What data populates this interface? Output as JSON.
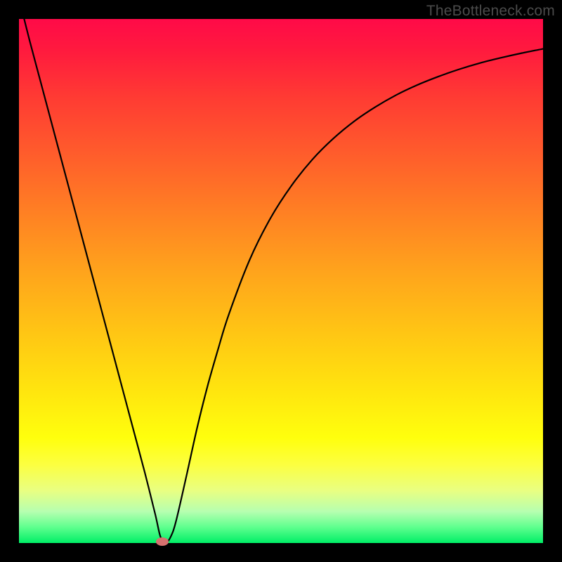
{
  "watermark": "TheBottleneck.com",
  "chart_data": {
    "type": "line",
    "title": "",
    "xlabel": "",
    "ylabel": "",
    "xlim": [
      0,
      100
    ],
    "ylim": [
      0,
      100
    ],
    "grid": false,
    "background_gradient": {
      "top": "#ff0a48",
      "mid": "#ffc614",
      "bottom": "#00ee66"
    },
    "series": [
      {
        "name": "bottleneck-curve",
        "x": [
          0,
          2,
          4,
          6,
          8,
          10,
          12,
          14,
          16,
          18,
          20,
          22,
          24,
          26,
          27,
          28,
          29,
          30,
          32,
          34,
          36,
          38,
          40,
          44,
          48,
          52,
          56,
          60,
          64,
          68,
          72,
          76,
          80,
          84,
          88,
          92,
          96,
          100
        ],
        "y": [
          104,
          96,
          88.5,
          81,
          73.5,
          66,
          58.5,
          51,
          43.5,
          36,
          28.5,
          21,
          13.5,
          5.5,
          1.2,
          0.0,
          1.3,
          4.3,
          13,
          22,
          30,
          37,
          43.5,
          54,
          62,
          68.2,
          73.2,
          77.2,
          80.5,
          83.2,
          85.5,
          87.4,
          89.0,
          90.4,
          91.6,
          92.6,
          93.5,
          94.3
        ]
      }
    ],
    "marker": {
      "x": 27.3,
      "y": 0.3,
      "color": "#d6716f"
    },
    "annotations": []
  }
}
